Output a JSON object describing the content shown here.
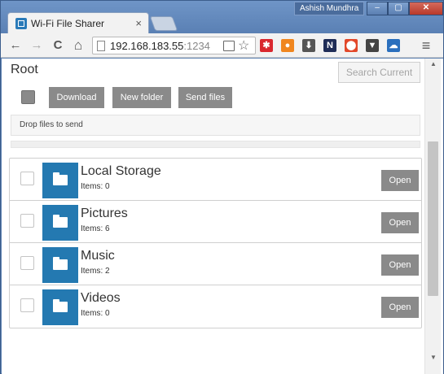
{
  "window": {
    "tab_title": "Wi-Fi File Sharer",
    "tab_close": "×",
    "user_name": "Ashish Mundhra",
    "min_glyph": "–",
    "max_glyph": "▢",
    "close_glyph": "✕"
  },
  "toolbar": {
    "back_glyph": "←",
    "forward_glyph": "→",
    "reload_glyph": "C",
    "home_glyph": "⌂",
    "url_host": "192.168.183.55",
    "url_port": ":1234",
    "star_glyph": "☆",
    "menu_glyph": "≡",
    "extensions": [
      {
        "name": "red-box-extension",
        "glyph": "✱",
        "color": "#d9272e"
      },
      {
        "name": "fox-extension",
        "glyph": "●",
        "color": "#f0861f"
      },
      {
        "name": "download-extension",
        "glyph": "⬇",
        "color": "#555555"
      },
      {
        "name": "notion-extension",
        "glyph": "N",
        "color": "#1f2d57"
      },
      {
        "name": "stop-extension",
        "glyph": "⬤",
        "color": "#e2482a"
      },
      {
        "name": "pocket-extension",
        "glyph": "▼",
        "color": "#444444"
      },
      {
        "name": "cloud-extension",
        "glyph": "☁",
        "color": "#2a6fbd"
      }
    ]
  },
  "page": {
    "root_label": "Root",
    "search_button": "Search Current",
    "download_button": "Download",
    "new_folder_button": "New folder",
    "send_files_button": "Send files",
    "drop_zone": "Drop files to send",
    "folders": [
      {
        "name": "Local Storage",
        "items": "Items: 0",
        "open": "Open"
      },
      {
        "name": "Pictures",
        "items": "Items: 6",
        "open": "Open"
      },
      {
        "name": "Music",
        "items": "Items: 2",
        "open": "Open"
      },
      {
        "name": "Videos",
        "items": "Items: 0",
        "open": "Open"
      }
    ],
    "colors": {
      "folder_tile": "#2479b1",
      "button_gray": "#8a8a8a"
    }
  }
}
